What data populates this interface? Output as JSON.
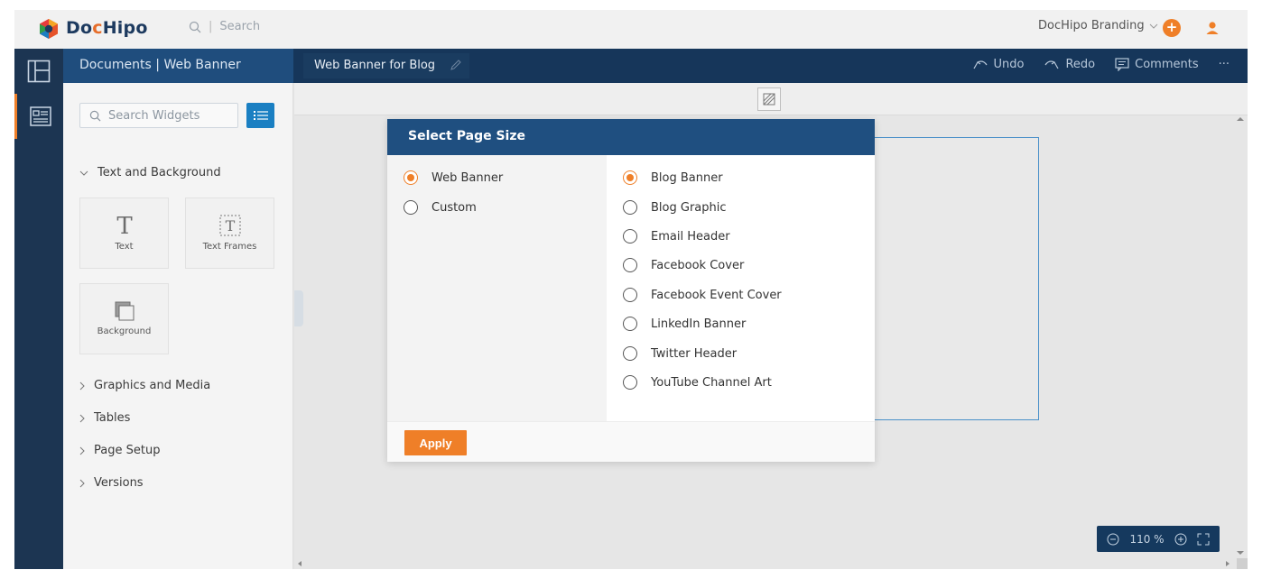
{
  "app": {
    "logo_prefix": "Do",
    "logo_o": "c",
    "logo_suffix": "Hipo",
    "search_placeholder": "Search",
    "brand_menu": "DocHipo Branding",
    "plus": "+"
  },
  "docbar": {
    "breadcrumb": "Documents | Web Banner",
    "doc_title": "Web Banner for Blog",
    "undo": "Undo",
    "redo": "Redo",
    "comments": "Comments",
    "more": "···"
  },
  "widgets": {
    "search_placeholder": "Search Widgets",
    "sections": {
      "text_bg": "Text and Background",
      "graphics": "Graphics and Media",
      "tables": "Tables",
      "page_setup": "Page Setup",
      "versions": "Versions"
    },
    "tiles": {
      "text": "Text",
      "text_frames": "Text Frames",
      "background": "Background"
    }
  },
  "canvas": {
    "zoom": "110 %"
  },
  "modal": {
    "title": "Select Page Size",
    "apply": "Apply",
    "categories": [
      {
        "label": "Web Banner",
        "selected": true
      },
      {
        "label": "Custom",
        "selected": false
      }
    ],
    "sizes": [
      {
        "label": "Blog Banner",
        "selected": true
      },
      {
        "label": "Blog Graphic",
        "selected": false
      },
      {
        "label": "Email Header",
        "selected": false
      },
      {
        "label": "Facebook Cover",
        "selected": false
      },
      {
        "label": "Facebook Event Cover",
        "selected": false
      },
      {
        "label": "LinkedIn Banner",
        "selected": false
      },
      {
        "label": "Twitter Header",
        "selected": false
      },
      {
        "label": "YouTube Channel Art",
        "selected": false
      }
    ]
  },
  "colors": {
    "accent": "#ef7f28",
    "header_dark": "#16365a",
    "modal_header": "#1f4f80"
  }
}
